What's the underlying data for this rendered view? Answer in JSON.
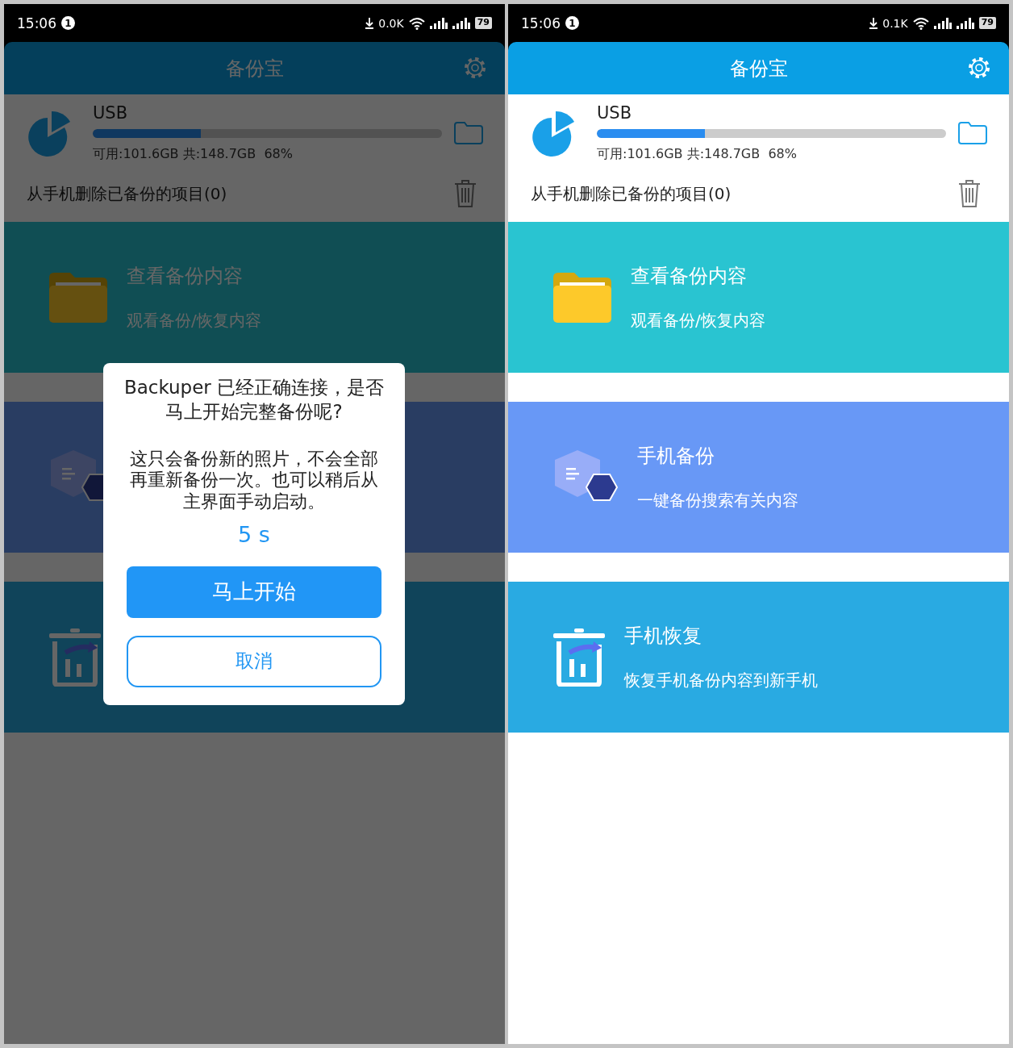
{
  "screens": [
    {
      "dimmed": true,
      "status_bar": {
        "time": "15:06",
        "notification_count": "1",
        "net_speed": "0.0K",
        "battery": "79"
      },
      "app_bar": {
        "title": "备份宝"
      },
      "storage": {
        "name": "USB",
        "level": 0.31,
        "info": "可用:101.6GB 共:148.7GB  68%"
      },
      "delete_row": {
        "label": "从手机删除已备份的项目(0)"
      },
      "cards": [
        {
          "kind": "browse",
          "title": "查看备份内容",
          "subtitle": "观看备份/恢复内容"
        },
        {
          "kind": "backup"
        },
        {
          "kind": "restore"
        }
      ],
      "dialog": {
        "title": "Backuper 已经正确连接，是否马上开始完整备份呢?",
        "message": "这只会备份新的照片，不会全部再重新备份一次。也可以稍后从主界面手动启动。",
        "countdown": "5 s",
        "buttons": [
          {
            "kind": "primary",
            "label": "马上开始"
          },
          {
            "kind": "outline",
            "label": "取消"
          }
        ]
      }
    },
    {
      "dimmed": false,
      "status_bar": {
        "time": "15:06",
        "notification_count": "1",
        "net_speed": "0.1K",
        "battery": "79"
      },
      "app_bar": {
        "title": "备份宝"
      },
      "storage": {
        "name": "USB",
        "level": 0.31,
        "info": "可用:101.6GB 共:148.7GB  68%"
      },
      "delete_row": {
        "label": "从手机删除已备份的项目(0)"
      },
      "cards": [
        {
          "kind": "browse",
          "title": "查看备份内容",
          "subtitle": "观看备份/恢复内容"
        },
        {
          "kind": "backup",
          "title": "手机备份",
          "subtitle": "一键备份搜索有关内容"
        },
        {
          "kind": "restore",
          "title": "手机恢复",
          "subtitle": "恢复手机备份内容到新手机"
        }
      ]
    }
  ]
}
